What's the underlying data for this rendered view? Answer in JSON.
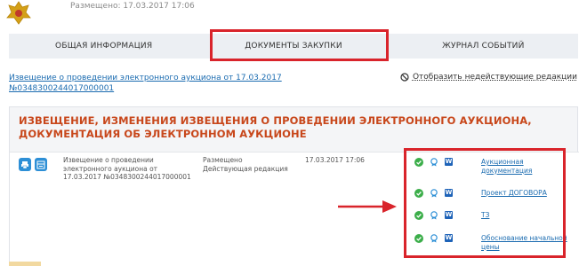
{
  "header": {
    "placed_text": "Размещено: 17.03.2017 17:06"
  },
  "tabs": [
    {
      "label": "ОБЩАЯ ИНФОРМАЦИЯ",
      "active": false
    },
    {
      "label": "ДОКУМЕНТЫ ЗАКУПКИ",
      "active": true
    },
    {
      "label": "ЖУРНАЛ СОБЫТИЙ",
      "active": false
    }
  ],
  "notice_link": "Извещение о проведении электронного аукциона от 17.03.2017 №0348300244017000001",
  "show_inactive_label": "Отобразить недействующие редакции",
  "section": {
    "title": "ИЗВЕЩЕНИЕ, ИЗМЕНЕНИЯ ИЗВЕЩЕНИЯ О ПРОВЕДЕНИИ ЭЛЕКТРОННОГО АУКЦИОНА, ДОКУМЕНТАЦИЯ ОБ ЭЛЕКТРОННОМ АУКЦИОНЕ",
    "row": {
      "description": "Извещение о проведении электронного аукциона от 17.03.2017 №0348300244017000001",
      "status_line1": "Размещено",
      "status_line2": "Действующая редакция",
      "date": "17.03.2017 17:06",
      "files": [
        {
          "name": "Аукционная документация",
          "icon": "word-icon"
        },
        {
          "name": "Проект ДОГОВОРА",
          "icon": "word-icon"
        },
        {
          "name": "ТЗ",
          "icon": "word-icon"
        },
        {
          "name": "Обоснование начальной цены",
          "icon": "word-icon"
        }
      ],
      "word_letter": "W"
    }
  },
  "colors": {
    "accent_red": "#d9242b",
    "link_blue": "#1a6bb0",
    "title_orange": "#c8471b",
    "icon_blue": "#2d8fd6",
    "ok_green": "#3cae4a"
  }
}
